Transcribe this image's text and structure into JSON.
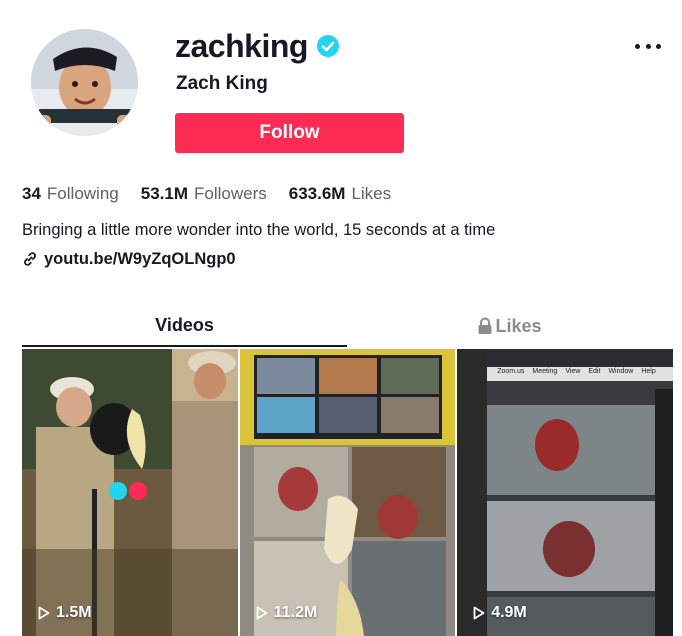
{
  "profile": {
    "username": "zachking",
    "nickname": "Zach King",
    "verified": true,
    "follow_label": "Follow",
    "accent_color": "#fe2c55",
    "verified_color": "#20d5ec"
  },
  "stats": [
    {
      "value": "34",
      "label": "Following"
    },
    {
      "value": "53.1M",
      "label": "Followers"
    },
    {
      "value": "633.6M",
      "label": "Likes"
    }
  ],
  "bio": "Bringing a little more wonder into the world, 15 seconds at a time",
  "link": {
    "text": "youtu.be/W9yZqOLNgp0",
    "icon": "link-icon"
  },
  "tabs": [
    {
      "label": "Videos",
      "active": true
    },
    {
      "label": "Likes",
      "active": false,
      "icon": "lock-icon"
    }
  ],
  "videos": [
    {
      "views": "1.5M",
      "icon": "play-icon"
    },
    {
      "views": "11.2M",
      "icon": "play-icon"
    },
    {
      "views": "4.9M",
      "icon": "play-icon"
    }
  ],
  "thumb2_menu": [
    "Zoom.us",
    "Meeting",
    "View",
    "Edit",
    "Window",
    "Help"
  ]
}
